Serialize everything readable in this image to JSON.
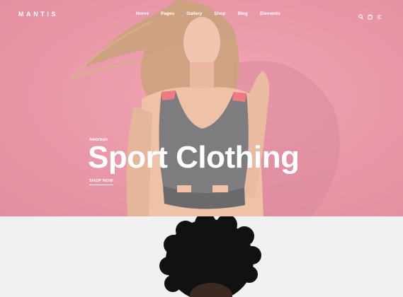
{
  "brand": {
    "logo": "MANTIS"
  },
  "nav": {
    "items": [
      {
        "label": "Home"
      },
      {
        "label": "Pages"
      },
      {
        "label": "Gallery"
      },
      {
        "label": "Shop"
      },
      {
        "label": "Blog"
      },
      {
        "label": "Elements"
      }
    ],
    "icons": [
      "search-icon",
      "cart-icon",
      "menu-icon"
    ]
  },
  "hero": {
    "tag": "#woman",
    "title": "Sport Clothing",
    "cta_label": "SHOP NOW"
  },
  "colors": {
    "hero_background": "#eb9aaa",
    "text": "#ffffff",
    "section_background": "#f1f1f1"
  }
}
